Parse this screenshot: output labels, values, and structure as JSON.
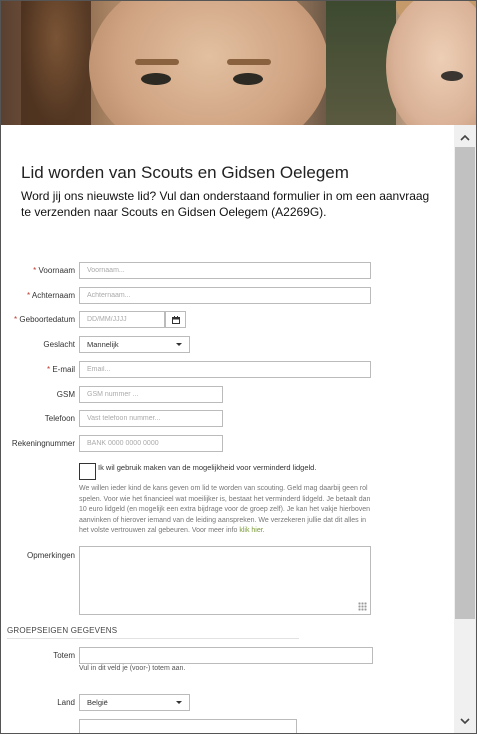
{
  "form": {
    "title": "Lid worden van Scouts en Gidsen Oelegem",
    "intro": "Word jij ons nieuwste lid? Vul dan onderstaand formulier in om een aanvraag te verzenden naar Scouts en Gidsen Oelegem (A2269G).",
    "required_mark": "*",
    "fields": {
      "voornaam": {
        "label": "Voornaam",
        "placeholder": "Voornaam..."
      },
      "achternaam": {
        "label": "Achternaam",
        "placeholder": "Achternaam..."
      },
      "geboortedatum": {
        "label": "Geboortedatum",
        "placeholder": "DD/MM/JJJJ"
      },
      "geslacht": {
        "label": "Geslacht",
        "value": "Mannelijk"
      },
      "email": {
        "label": "E-mail",
        "placeholder": "Email..."
      },
      "gsm": {
        "label": "GSM",
        "placeholder": "GSM nummer ..."
      },
      "telefoon": {
        "label": "Telefoon",
        "placeholder": "Vast telefoon nummer..."
      },
      "rekeningnummer": {
        "label": "Rekeningnummer",
        "placeholder": "BANK 0000 0000 0000"
      },
      "opmerkingen": {
        "label": "Opmerkingen"
      }
    },
    "verminderd": {
      "checkbox_label": "Ik wil gebruik maken van de mogelijkheid voor verminderd lidgeld.",
      "help_text": "We willen ieder kind de kans geven om lid te worden van scouting. Geld mag daarbij geen rol spelen. Voor wie het financieel wat moeilijker is, bestaat het verminderd lidgeld. Je betaalt dan 10 euro lidgeld (en mogelijk een extra bijdrage voor de groep zelf). Je kan het vakje hierboven aanvinken of hierover iemand van de leiding aanspreken. We verzekeren jullie dat dit alles in het volste vertrouwen zal gebeuren. Voor meer info",
      "link": "klik hier",
      "link_suffix": "."
    },
    "groepseigen": {
      "section_title": "GROEPSEIGEN GEGEVENS",
      "totem": {
        "label": "Totem",
        "help": "Vul in dit veld je (voor-) totem aan."
      },
      "land": {
        "label": "Land",
        "value": "België"
      }
    }
  },
  "icons": {
    "calendar": "calendar-icon",
    "scroll_up": "chevron-up-icon",
    "scroll_down": "chevron-down-icon",
    "resize": "resize-grip-icon"
  },
  "colors": {
    "required": "#c0392b",
    "link": "#7a9a36"
  }
}
